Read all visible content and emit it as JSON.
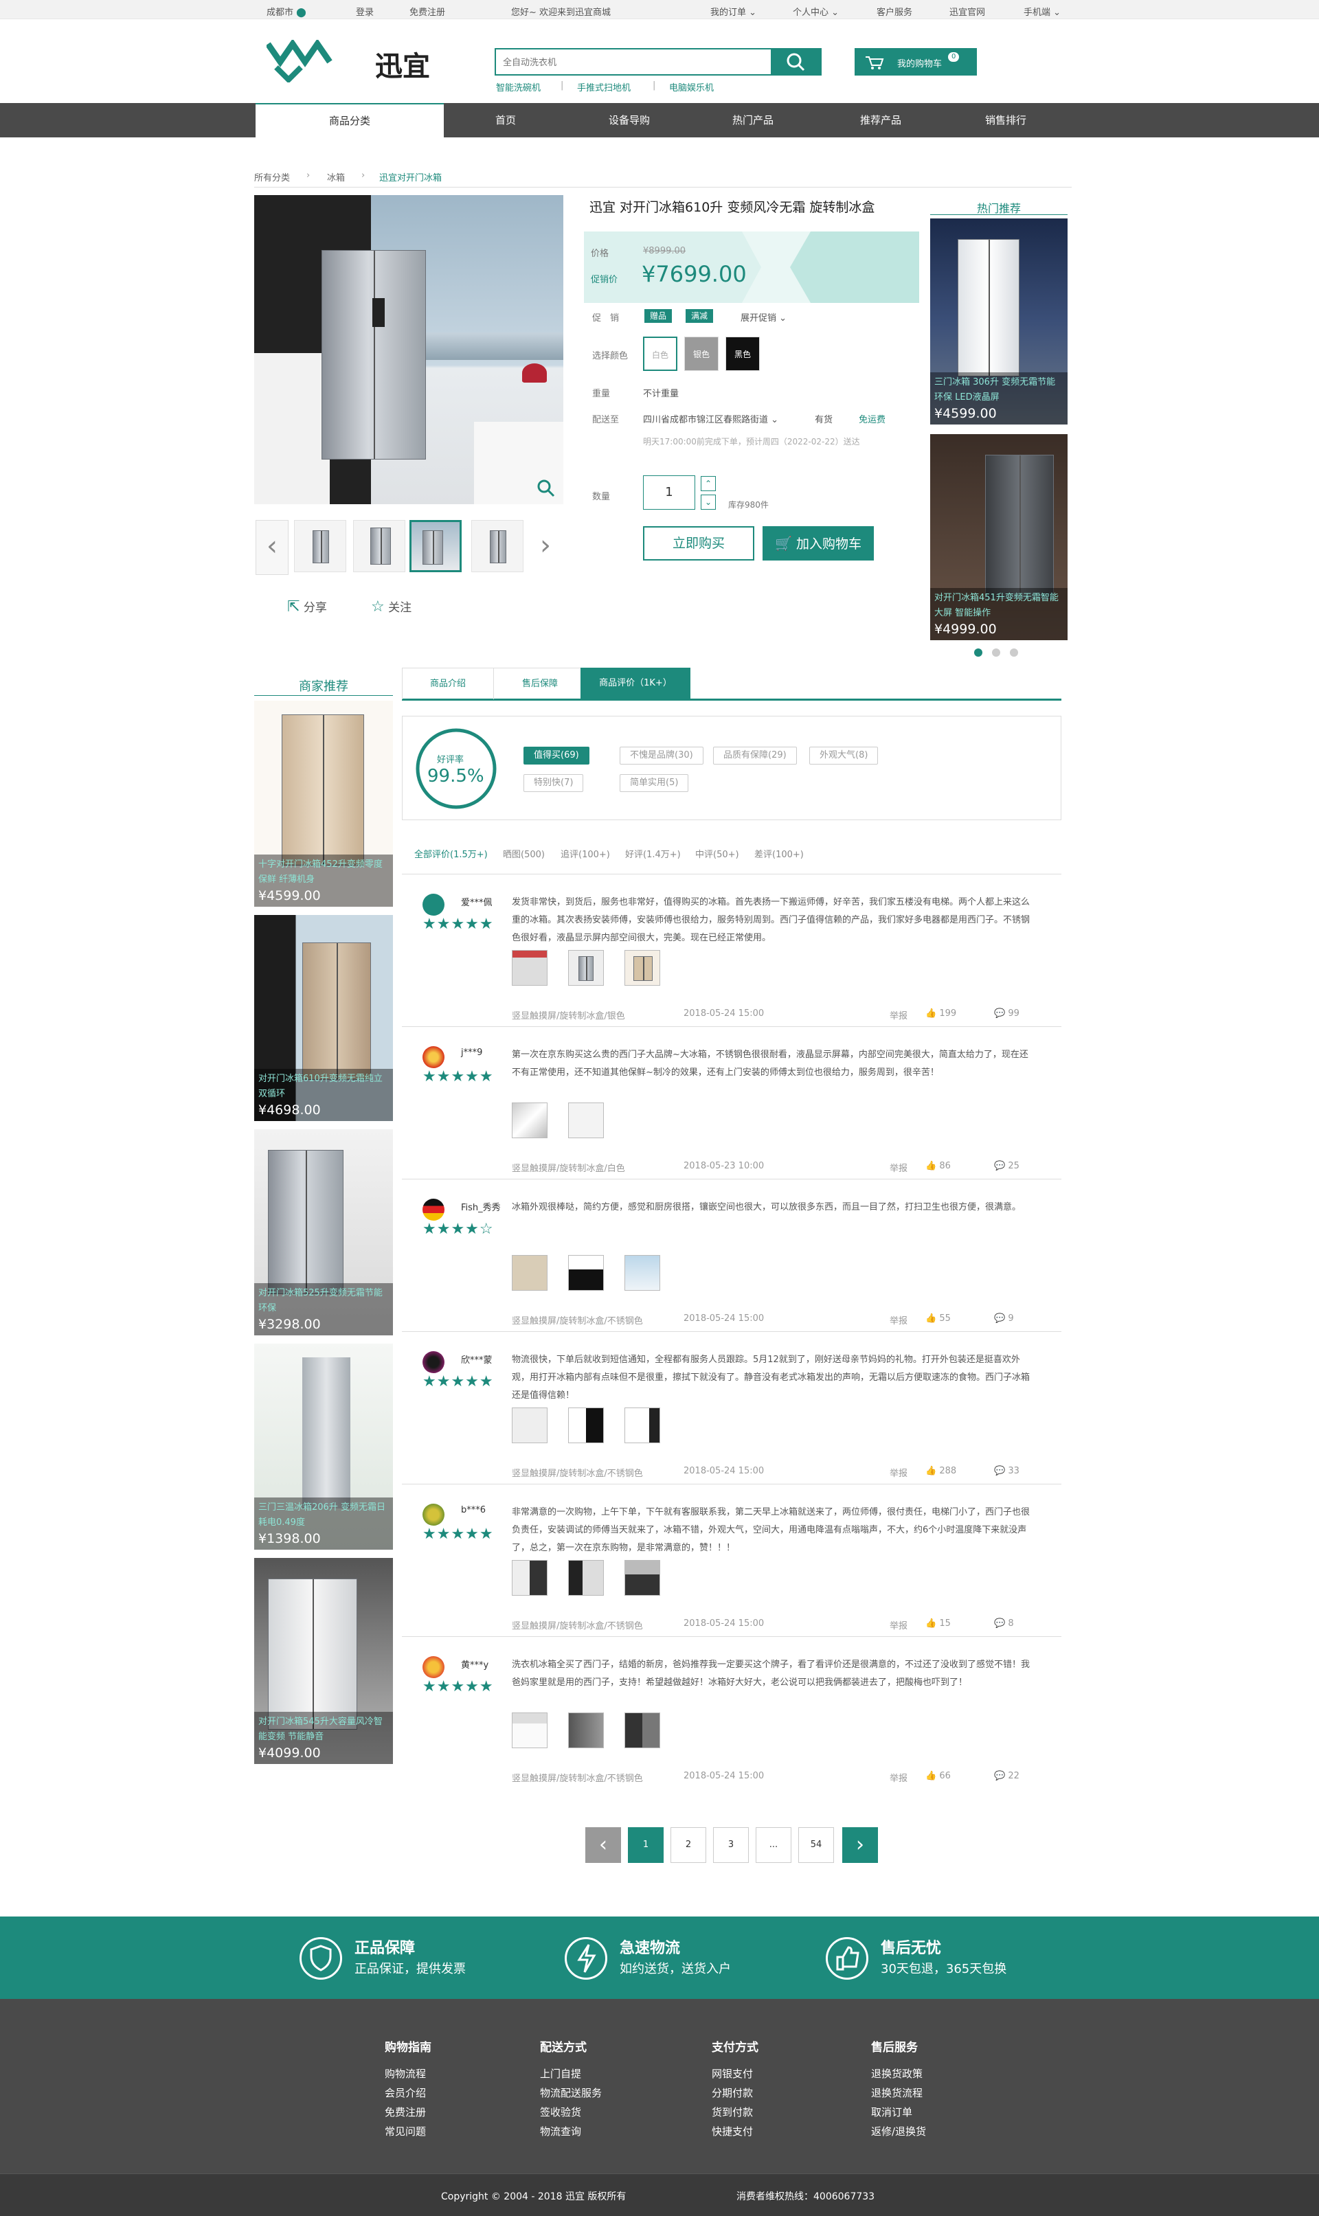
{
  "topbar": {
    "city": "成都市",
    "login": "登录",
    "register": "免费注册",
    "welcome": "您好~ 欢迎来到迅宜商城",
    "orders": "我的订单",
    "personal": "个人中心",
    "service": "客户服务",
    "official": "迅宜官网",
    "mobile": "手机端"
  },
  "header": {
    "logo_text": "迅宜",
    "search_placeholder": "全自动洗衣机",
    "hot_words": [
      "智能洗碗机",
      "手推式扫地机",
      "电脑娱乐机"
    ],
    "cart_label": "我的购物车",
    "cart_count": "0"
  },
  "nav": {
    "category": "商品分类",
    "items": [
      "首页",
      "设备导购",
      "热门产品",
      "推荐产品",
      "销售排行"
    ]
  },
  "breadcrumb": [
    "所有分类",
    "冰箱",
    "迅宜对开门冰箱"
  ],
  "product": {
    "title": "迅宜 对开门冰箱610升 变频风冷无霜 旋转制冰盒",
    "price_label": "价格",
    "original_price": "¥8999.00",
    "promo_label": "促销价",
    "promo_price": "¥7699.00",
    "sale_label": "促　销",
    "tag1": "赠品",
    "tag2": "满减",
    "expand": "展开促销",
    "color_label": "选择颜色",
    "colors": [
      "白色",
      "银色",
      "黑色"
    ],
    "weight_label": "重量",
    "weight": "不计重量",
    "ship_label": "配送至",
    "address": "四川省成都市锦江区春熙路街道",
    "stock_status": "有货",
    "free_ship": "免运费",
    "delivery_note": "明天17:00:00前完成下单，预计周四（2022-02-22）送达",
    "qty_label": "数量",
    "qty": "1",
    "stock_left": "库存980件",
    "buy_now": "立即购买",
    "add_cart": "加入购物车",
    "share": "分享",
    "follow": "关注"
  },
  "hot": {
    "title": "热门推荐",
    "items": [
      {
        "name": "三门冰箱 306升 变频无霜节能环保 LED液晶屏",
        "price": "¥4599.00"
      },
      {
        "name": "对开门冰箱451升变频无霜智能大屏 智能操作",
        "price": "¥4999.00"
      }
    ]
  },
  "merchant": {
    "title": "商家推荐",
    "items": [
      {
        "name": "十字对开门冰箱452升变频零度保鲜 纤薄机身",
        "price": "¥4599.00"
      },
      {
        "name": "对开门冰箱610升变频无霜纯立双循环",
        "price": "¥4698.00"
      },
      {
        "name": "对开门冰箱525升变频无霜节能环保",
        "price": "¥3298.00"
      },
      {
        "name": "三门三温冰箱206升 变频无霜日耗电0.49度",
        "price": "¥1398.00"
      },
      {
        "name": "对开门冰箱545升大容量风冷智能变频 节能静音",
        "price": "¥4099.00"
      }
    ]
  },
  "tabs": [
    "商品介绍",
    "售后保障",
    "商品评价（1K+）"
  ],
  "score": {
    "label": "好评率",
    "value": "99.5%",
    "tags": [
      "值得买(69)",
      "不愧是品牌(30)",
      "品质有保障(29)",
      "外观大气(8)",
      "特别快(7)",
      "简单实用(5)"
    ]
  },
  "filters": [
    "全部评价(1.5万+)",
    "晒图(500)",
    "追评(100+)",
    "好评(1.4万+)",
    "中评(50+)",
    "差评(100+)"
  ],
  "reviews": [
    {
      "user": "爱***佩",
      "stars": "★★★★★",
      "text": "发货非常快，到货后，服务也非常好，值得购买的冰箱。首先表扬一下搬运师傅，好辛苦，我们家五楼没有电梯。两个人都上来这么重的冰箱。其次表扬安装师傅，安装师傅也很给力，服务特别周到。西门子值得信赖的产品，我们家好多电器都是用西门子。不锈钢色很好看，液晶显示屏内部空间很大，完美。现在已经正常使用。",
      "spec": "竖显触摸屏/旋转制冰盒/银色",
      "date": "2018-05-24 15:00",
      "report": "举报",
      "likes": "199",
      "comments": "99"
    },
    {
      "user": "j***9",
      "stars": "★★★★★",
      "text": "第一次在京东购买这么贵的西门子大品牌~大冰箱，不锈钢色很很耐看，液晶显示屏幕，内部空间完美很大，简直太给力了，现在还不有正常使用，还不知道其他保鲜~制冷的效果，还有上门安装的师傅太到位也很给力，服务周到，很辛苦！",
      "spec": "竖显触摸屏/旋转制冰盒/白色",
      "date": "2018-05-23 10:00",
      "report": "举报",
      "likes": "86",
      "comments": "25"
    },
    {
      "user": "Fish_秀秀",
      "stars": "★★★★☆",
      "text": "冰箱外观很棒哒，简约方便，感觉和厨房很搭，镶嵌空间也很大，可以放很多东西，而且一目了然，打扫卫生也很方便，很满意。",
      "spec": "竖显触摸屏/旋转制冰盒/不锈钢色",
      "date": "2018-05-24 15:00",
      "report": "举报",
      "likes": "55",
      "comments": "9"
    },
    {
      "user": "欣***蒙",
      "stars": "★★★★★",
      "text": "物流很快，下单后就收到短信通知，全程都有服务人员跟踪。5月12就到了，刚好送母亲节妈妈的礼物。打开外包装还是挺喜欢外观，用打开冰箱内部有点味但不是很重，擦拭下就没有了。静音没有老式冰箱发出的声响，无霜以后方便取速冻的食物。西门子冰箱还是值得信赖！",
      "spec": "竖显触摸屏/旋转制冰盒/不锈钢色",
      "date": "2018-05-24 15:00",
      "report": "举报",
      "likes": "288",
      "comments": "33"
    },
    {
      "user": "b***6",
      "stars": "★★★★★",
      "text": "非常满意的一次购物，上午下单，下午就有客服联系我，第二天早上冰箱就送来了，两位师傅，很付责任，电梯门小了，西门子也很负责任，安装调试的师傅当天就来了，冰箱不错，外观大气，空间大，用通电降温有点嗡嗡声，不大，约6个小时温度降下来就没声了，总之，第一次在京东购物，是非常满意的，赞！！！",
      "spec": "竖显触摸屏/旋转制冰盒/不锈钢色",
      "date": "2018-05-24 15:00",
      "report": "举报",
      "likes": "15",
      "comments": "8"
    },
    {
      "user": "黄***y",
      "stars": "★★★★★",
      "text": "洗衣机冰箱全买了西门子，结婚的新房，爸妈推荐我一定要买这个牌子，看了看评价还是很满意的，不过还了没收到了感觉不错！我爸妈家里就是用的西门子，支持！希望越做越好！冰箱好大好大，老公说可以把我俩都装进去了，把酸梅也吓到了！",
      "spec": "竖显触摸屏/旋转制冰盒/不锈钢色",
      "date": "2018-05-24 15:00",
      "report": "举报",
      "likes": "66",
      "comments": "22"
    }
  ],
  "pager": {
    "pages": [
      "1",
      "2",
      "3",
      "...",
      "54"
    ]
  },
  "service": [
    {
      "t1": "正品保障",
      "t2": "正品保证，提供发票"
    },
    {
      "t1": "急速物流",
      "t2": "如约送货，送货入户"
    },
    {
      "t1": "售后无忧",
      "t2": "30天包退，365天包换"
    }
  ],
  "footer": {
    "cols": [
      {
        "h": "购物指南",
        "links": [
          "购物流程",
          "会员介绍",
          "免费注册",
          "常见问题"
        ]
      },
      {
        "h": "配送方式",
        "links": [
          "上门自提",
          "物流配送服务",
          "签收验货",
          "物流查询"
        ]
      },
      {
        "h": "支付方式",
        "links": [
          "网银支付",
          "分期付款",
          "货到付款",
          "快捷支付"
        ]
      },
      {
        "h": "售后服务",
        "links": [
          "退换货政策",
          "退换货流程",
          "取消订单",
          "返修/退换货"
        ]
      }
    ],
    "copyright": "Copyright © 2004 - 2018  迅宜 版权所有",
    "hotline": "消费者维权热线：4006067733"
  },
  "colors": {
    "accent": "#1d8a7c",
    "dark": "#4a4a4a"
  }
}
